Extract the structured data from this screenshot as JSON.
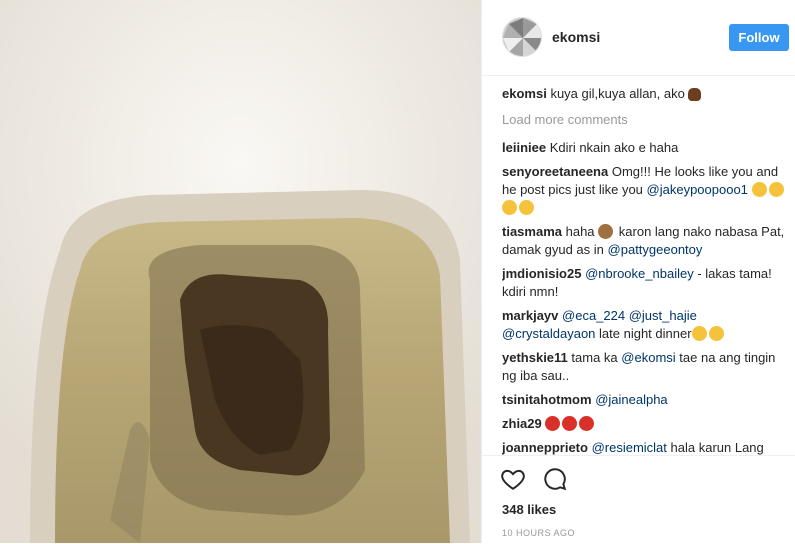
{
  "post": {
    "username": "ekomsi",
    "follow_label": "Follow",
    "caption_user": "ekomsi",
    "caption_text": "kuya gil,kuya allan, ako",
    "load_more": "Load more comments",
    "likes": "348 likes",
    "timestamp": "10 HOURS AGO"
  },
  "comments": [
    {
      "user": "leiiniee",
      "text": "Kdiri nkain ako e haha"
    },
    {
      "user": "senyoreetaneena",
      "text": "Omg!!! He looks like you and he post pics just like you",
      "mention": "@jakeypoopooo1"
    },
    {
      "user": "tiasmama",
      "text1": "haha",
      "text2": "karon lang nako nabasa Pat, damak gyud as in",
      "mention": "@pattygeeontoy"
    },
    {
      "user": "jmdionisio25",
      "mention": "@nbrooke_nbailey",
      "text": "- lakas tama! kdiri nmn!"
    },
    {
      "user": "markjayv",
      "mention1": "@eca_224",
      "mention2": "@just_hajie",
      "mention3": "@crystaldayaon",
      "text": "late night dinner"
    },
    {
      "user": "yethskie11",
      "text1": "tama ka",
      "mention": "@ekomsi",
      "text2": "tae na ang tingin ng iba sau.."
    },
    {
      "user": "tsinitahotmom",
      "mention": "@jainealpha"
    },
    {
      "user": "zhia29"
    },
    {
      "user": "joannepprieto",
      "mention": "@resiemiclat",
      "text": "hala karun Lang"
    }
  ],
  "icons": {
    "like": "heart-icon",
    "comment": "comment-icon",
    "poop": "poop-emoji-icon"
  }
}
